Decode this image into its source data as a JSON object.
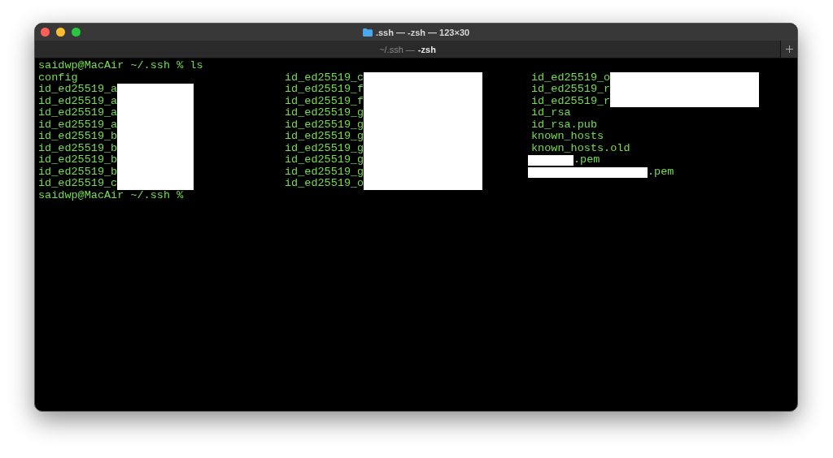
{
  "window": {
    "title": ".ssh — -zsh — 123×30"
  },
  "tabs": [
    {
      "path": "~/.ssh —",
      "label": "-zsh",
      "selected": true
    }
  ],
  "terminal": {
    "command_line": "saidwp@MacAir ~/.ssh % ls",
    "columns": [
      [
        {
          "kind": "plain",
          "text": "config"
        },
        {
          "kind": "masked",
          "text": "id_ed25519_a"
        },
        {
          "kind": "masked",
          "text": "id_ed25519_a"
        },
        {
          "kind": "masked",
          "text": "id_ed25519_a"
        },
        {
          "kind": "masked",
          "text": "id_ed25519_a"
        },
        {
          "kind": "masked",
          "text": "id_ed25519_b"
        },
        {
          "kind": "masked",
          "text": "id_ed25519_b"
        },
        {
          "kind": "masked",
          "text": "id_ed25519_b"
        },
        {
          "kind": "masked",
          "text": "id_ed25519_b"
        },
        {
          "kind": "masked",
          "text": "id_ed25519_c"
        }
      ],
      [
        {
          "kind": "masked",
          "text": "id_ed25519_c"
        },
        {
          "kind": "masked",
          "text": "id_ed25519_f"
        },
        {
          "kind": "masked",
          "text": "id_ed25519_f"
        },
        {
          "kind": "masked",
          "text": "id_ed25519_g"
        },
        {
          "kind": "masked",
          "text": "id_ed25519_g"
        },
        {
          "kind": "masked",
          "text": "id_ed25519_g"
        },
        {
          "kind": "masked",
          "text": "id_ed25519_g"
        },
        {
          "kind": "masked",
          "text": "id_ed25519_g"
        },
        {
          "kind": "masked",
          "text": "id_ed25519_g"
        },
        {
          "kind": "masked",
          "text": "id_ed25519_o"
        }
      ],
      [
        {
          "kind": "masked",
          "text": "id_ed25519_o"
        },
        {
          "kind": "masked",
          "text": "id_ed25519_r"
        },
        {
          "kind": "masked",
          "text": "id_ed25519_r"
        },
        {
          "kind": "plain",
          "text": "id_rsa"
        },
        {
          "kind": "plain",
          "text": "id_rsa.pub"
        },
        {
          "kind": "plain",
          "text": "known_hosts"
        },
        {
          "kind": "plain",
          "text": "known_hosts.old"
        },
        {
          "kind": "premasked",
          "text": ".pem"
        },
        {
          "kind": "premasked",
          "text": ".pem"
        }
      ]
    ],
    "prompt": "saidwp@MacAir ~/.ssh %"
  }
}
